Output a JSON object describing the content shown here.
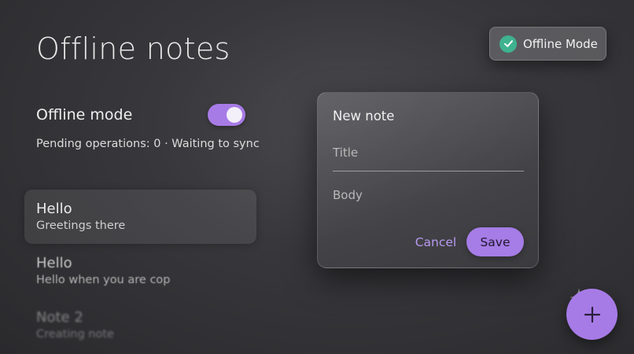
{
  "page": {
    "title": "Offline notes"
  },
  "offline": {
    "label": "Offline mode",
    "enabled": true,
    "pending_text": "Pending operations: 0 · Waiting to sync"
  },
  "notes": [
    {
      "title": "Hello",
      "subtitle": "Greetings there"
    },
    {
      "title": "Hello",
      "subtitle": "Hello when you are cop"
    },
    {
      "title": "Note 2",
      "subtitle": "Creating note"
    }
  ],
  "badge": {
    "label": "Offline Mode",
    "icon": "check-icon",
    "color": "#3fb28e"
  },
  "dialog": {
    "title": "New note",
    "title_placeholder": "Title",
    "body_placeholder": "Body",
    "cancel_label": "Cancel",
    "save_label": "Save"
  },
  "fab": {
    "icon": "plus-icon"
  },
  "colors": {
    "accent": "#a77be6",
    "success": "#3fb28e",
    "background": "#38383c"
  }
}
